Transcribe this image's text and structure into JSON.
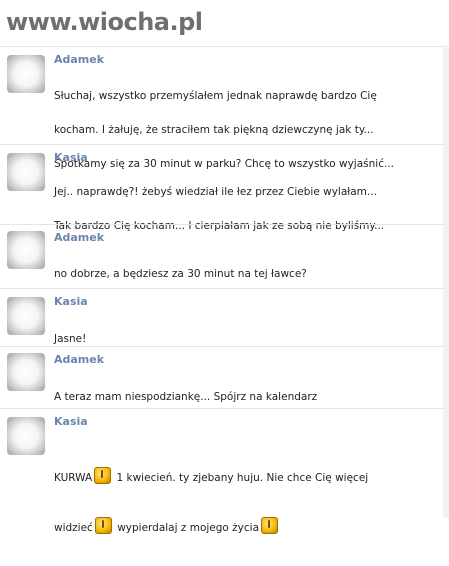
{
  "watermark": "www.wiocha.pl",
  "messages": [
    {
      "sender": "Adamek",
      "lines": [
        "Słuchaj, wszystko przemyślałem jednak naprawdę bardzo Cię",
        "kocham. I żałuję, że straciłem tak piękną dziewczynę jak ty...",
        "Spotkamy się za 30 minut w parku? Chcę to wszystko wyjaśnić..."
      ]
    },
    {
      "sender": "Kasia",
      "lines": [
        "Jej.. naprawdę?! żebyś wiedział ile łez przez Ciebie wylałam...",
        "Tak bardzo Cię kocham... I cierpiałam jak ze sobą nie byliśmy..."
      ]
    },
    {
      "sender": "Adamek",
      "lines": [
        "no dobrze, a będziesz za 30 minut na tej ławce?"
      ]
    },
    {
      "sender": "Kasia",
      "lines": [
        "Jasne!"
      ]
    },
    {
      "sender": "Adamek",
      "lines": [
        "A teraz mam niespodziankę... Spójrz na kalendarz"
      ]
    },
    {
      "sender": "Kasia",
      "line1_part1": "KURWA",
      "line1_part2": "1 kwiecień. ty zjebany huju. Nie chce Cię więcej",
      "line2_part1": "widzieć",
      "line2_part2": "wypierdalaj z mojego życia",
      "emoticon_icon": "angry-emoticon-icon"
    }
  ]
}
